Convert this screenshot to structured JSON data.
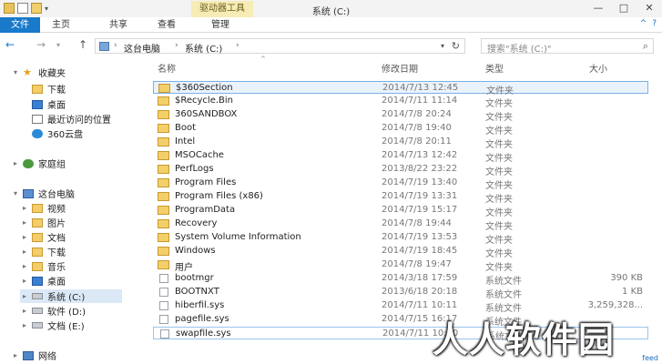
{
  "window": {
    "title": "系统 (C:)",
    "contextual_tab": "驱动器工具",
    "controls": [
      "—",
      "□",
      "✕"
    ]
  },
  "quick_access": {
    "dropdown_glyph": "▾"
  },
  "ribbon": {
    "tabs": [
      "文件",
      "主页",
      "共享",
      "查看",
      "管理"
    ],
    "right_glyphs": [
      "^",
      "?"
    ]
  },
  "address": {
    "back": "←",
    "forward": "→",
    "history": "▾",
    "up": "↑",
    "crumbs": [
      "这台电脑",
      "系统 (C:)"
    ],
    "separator": "›",
    "dropdown": "▾",
    "refresh": "↻",
    "search_placeholder": "搜索\"系统 (C:)\"",
    "search_glyph": "⌕"
  },
  "nav_pane": {
    "items": [
      {
        "label": "收藏夹",
        "icon": "star-icon",
        "expander": "▾"
      },
      {
        "label": "下载",
        "icon": "download-folder-icon",
        "expander": ""
      },
      {
        "label": "桌面",
        "icon": "desktop-icon",
        "expander": ""
      },
      {
        "label": "最近访问的位置",
        "icon": "recent-places-icon",
        "expander": ""
      },
      {
        "label": "360云盘",
        "icon": "cloud-icon",
        "expander": ""
      },
      {
        "label": "家庭组",
        "icon": "homegroup-icon",
        "expander": "▸"
      },
      {
        "label": "这台电脑",
        "icon": "computer-icon",
        "expander": "▾"
      },
      {
        "label": "视频",
        "icon": "video-folder-icon",
        "expander": "▸"
      },
      {
        "label": "图片",
        "icon": "pictures-folder-icon",
        "expander": "▸"
      },
      {
        "label": "文档",
        "icon": "documents-folder-icon",
        "expander": "▸"
      },
      {
        "label": "下载",
        "icon": "download-folder-icon",
        "expander": "▸"
      },
      {
        "label": "音乐",
        "icon": "music-folder-icon",
        "expander": "▸"
      },
      {
        "label": "桌面",
        "icon": "desktop-icon",
        "expander": "▸"
      },
      {
        "label": "系统 (C:)",
        "icon": "drive-icon",
        "expander": "▸"
      },
      {
        "label": "软件 (D:)",
        "icon": "drive-icon",
        "expander": "▸"
      },
      {
        "label": "文档 (E:)",
        "icon": "drive-icon",
        "expander": "▸"
      },
      {
        "label": "网络",
        "icon": "network-icon",
        "expander": "▸"
      }
    ]
  },
  "columns": {
    "name": "名称",
    "date": "修改日期",
    "type": "类型",
    "size": "大小",
    "sort_arrow": "^"
  },
  "files": [
    {
      "name": "$360Section",
      "date": "2014/7/13 12:45",
      "type": "文件夹",
      "size": "",
      "kind": "folder"
    },
    {
      "name": "$Recycle.Bin",
      "date": "2014/7/11 11:14",
      "type": "文件夹",
      "size": "",
      "kind": "folder"
    },
    {
      "name": "360SANDBOX",
      "date": "2014/7/8 20:24",
      "type": "文件夹",
      "size": "",
      "kind": "folder"
    },
    {
      "name": "Boot",
      "date": "2014/7/8 19:40",
      "type": "文件夹",
      "size": "",
      "kind": "folder"
    },
    {
      "name": "Intel",
      "date": "2014/7/8 20:11",
      "type": "文件夹",
      "size": "",
      "kind": "folder"
    },
    {
      "name": "MSOCache",
      "date": "2014/7/13 12:42",
      "type": "文件夹",
      "size": "",
      "kind": "folder"
    },
    {
      "name": "PerfLogs",
      "date": "2013/8/22 23:22",
      "type": "文件夹",
      "size": "",
      "kind": "folder"
    },
    {
      "name": "Program Files",
      "date": "2014/7/19 13:40",
      "type": "文件夹",
      "size": "",
      "kind": "folder"
    },
    {
      "name": "Program Files (x86)",
      "date": "2014/7/19 13:31",
      "type": "文件夹",
      "size": "",
      "kind": "folder"
    },
    {
      "name": "ProgramData",
      "date": "2014/7/19 15:17",
      "type": "文件夹",
      "size": "",
      "kind": "folder"
    },
    {
      "name": "Recovery",
      "date": "2014/7/8 19:44",
      "type": "文件夹",
      "size": "",
      "kind": "folder"
    },
    {
      "name": "System Volume Information",
      "date": "2014/7/19 13:53",
      "type": "文件夹",
      "size": "",
      "kind": "folder"
    },
    {
      "name": "Windows",
      "date": "2014/7/19 18:45",
      "type": "文件夹",
      "size": "",
      "kind": "folder"
    },
    {
      "name": "用户",
      "date": "2014/7/8 19:47",
      "type": "文件夹",
      "size": "",
      "kind": "folder"
    },
    {
      "name": "bootmgr",
      "date": "2014/3/18 17:59",
      "type": "系统文件",
      "size": "390 KB",
      "kind": "file"
    },
    {
      "name": "BOOTNXT",
      "date": "2013/6/18 20:18",
      "type": "系统文件",
      "size": "1 KB",
      "kind": "file"
    },
    {
      "name": "hiberfil.sys",
      "date": "2014/7/11 10:11",
      "type": "系统文件",
      "size": "3,259,328...",
      "kind": "file"
    },
    {
      "name": "pagefile.sys",
      "date": "2014/7/15 16:17",
      "type": "系统文件",
      "size": "",
      "kind": "file"
    },
    {
      "name": "swapfile.sys",
      "date": "2014/7/11 10:10",
      "type": "系统文件",
      "size": "",
      "kind": "file"
    }
  ],
  "watermark": "人人软件园",
  "corner_tag": "feed"
}
